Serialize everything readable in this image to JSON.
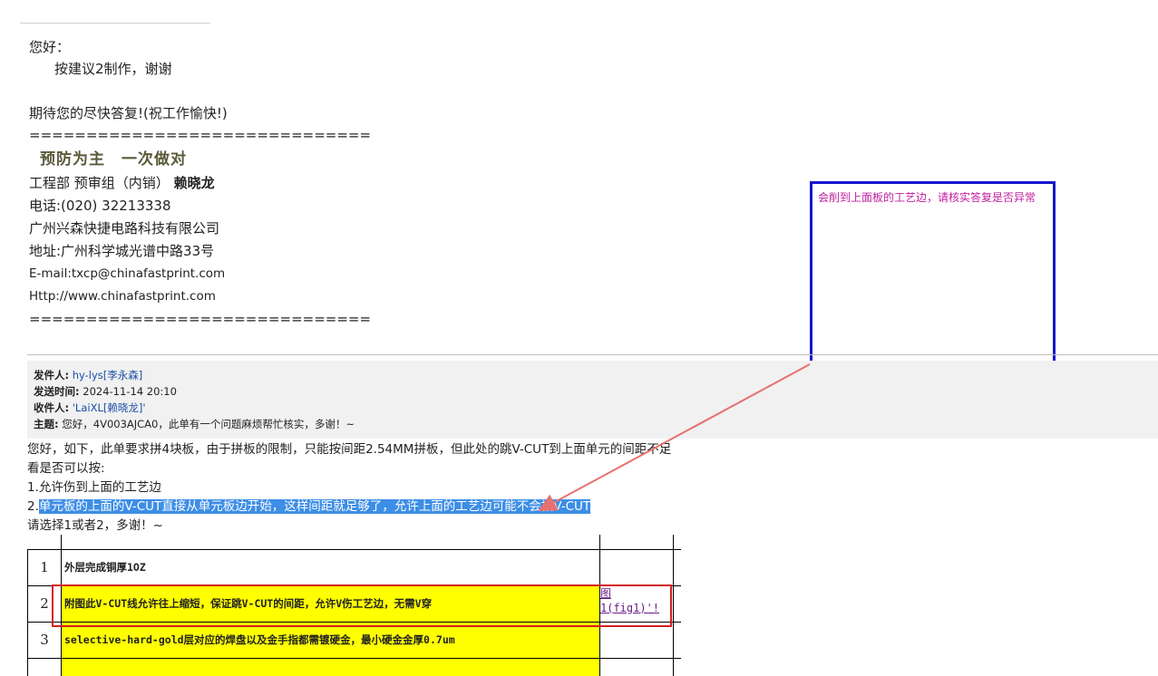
{
  "reply": {
    "greeting": "您好：",
    "line1": "按建议2制作，谢谢",
    "closing": "期待您的尽快答复!(祝工作愉快!)"
  },
  "signature": {
    "separator": "==============================",
    "motto": "预防为主　一次做对",
    "dept": "工程部 预审组（内销）",
    "name": "赖晓龙",
    "phone": "电话:(020) 32213338",
    "company": "广州兴森快捷电路科技有限公司",
    "address": "地址:广州科学城光谱中路33号",
    "email": "E-mail:txcp@chinafastprint.com",
    "website": "Http://www.chinafastprint.com"
  },
  "original_header": {
    "from_label": "发件人:",
    "from_value": "hy-lys[李永森]",
    "sent_label": "发送时间:",
    "sent_value": "2024-11-14 20:10",
    "to_label": "收件人:",
    "to_value": "'LaiXL[赖晓龙]'",
    "subject_label": "主题:",
    "subject_value": "您好，4V003AJCA0，此单有一个问题麻烦帮忙核实，多谢！~"
  },
  "original_body": {
    "line1": "您好，如下，此单要求拼4块板，由于拼板的限制，只能按间距2.54MM拼板，但此处的跳V-CUT到上面单元的间距不足",
    "line2": "看是否可以按:",
    "option1": "1.允许伤到上面的工艺边",
    "option2_prefix": "2.",
    "option2_highlight": "单元板的上面的V-CUT直接从单元板边开始，这样间距就足够了，允许上面的工艺边可能不会被V-CUT",
    "ask": "请选择1或者2，多谢！~"
  },
  "comment": {
    "text": "会削到上面板的工艺边，请核实答复是否异常"
  },
  "table": {
    "rows": [
      {
        "num": "1",
        "desc": "外层完成铜厚1OZ",
        "ref": ""
      },
      {
        "num": "2",
        "desc": "附图此V-CUT线允许往上缩短，保证跳V-CUT的间距，允许V伤工艺边，无需V穿",
        "ref_line1": "图",
        "ref_line2": "1(fig1)'!"
      },
      {
        "num": "3",
        "desc": "selective-hard-gold层对应的焊盘以及金手指都需镀硬金，最小硬金金厚0.7um",
        "ref": ""
      }
    ]
  },
  "colors": {
    "highlight": "#3d8ee6",
    "comment_border": "#1515d0",
    "comment_text": "#c01fa0",
    "arrow": "#e87070",
    "red_box": "#d21f1f",
    "yellow": "#ffff00"
  }
}
